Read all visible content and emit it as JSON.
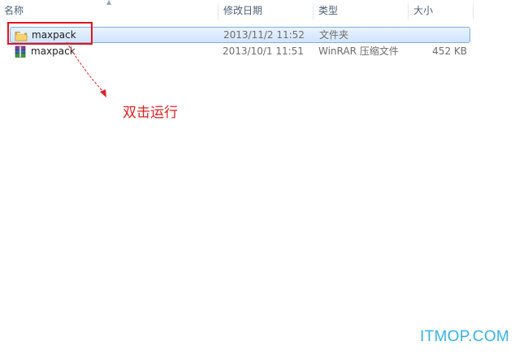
{
  "columns": {
    "name": "名称",
    "date_modified": "修改日期",
    "type": "类型",
    "size": "大小"
  },
  "files": [
    {
      "icon": "folder-icon",
      "name": "maxpack",
      "date_modified": "2013/11/2 11:52",
      "type": "文件夹",
      "size": "",
      "selected": true
    },
    {
      "icon": "winrar-archive-icon",
      "name": "maxpack",
      "date_modified": "2013/10/1 11:51",
      "type": "WinRAR 压缩文件",
      "size": "452 KB",
      "selected": false
    }
  ],
  "annotation": {
    "text": "双击运行",
    "color": "#e02020"
  },
  "watermark": "ITMOP.COM",
  "colors": {
    "selection_border": "#84acdd",
    "selection_fill": "#cfe4fb",
    "highlight_box": "#e4141e",
    "watermark": "#35b3e6"
  }
}
